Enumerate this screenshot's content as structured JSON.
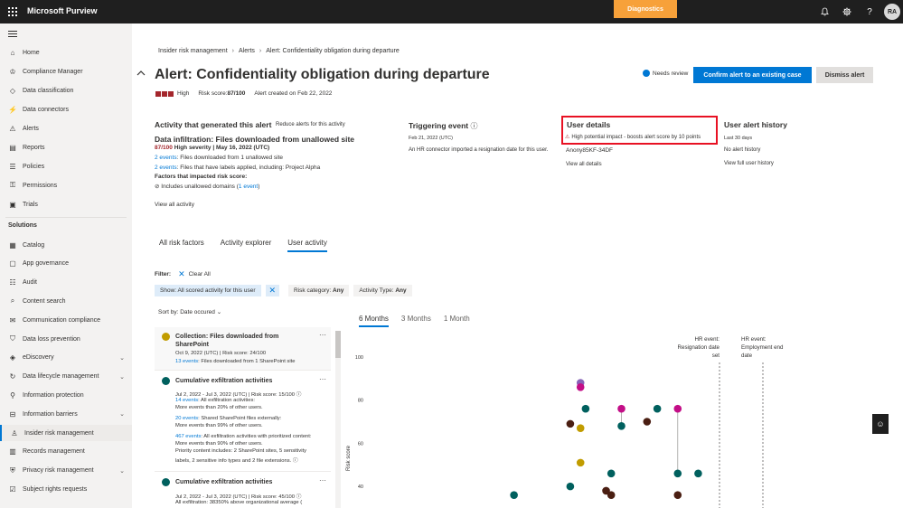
{
  "topbar": {
    "app_title": "Microsoft Purview",
    "diagnostics_label": "Diagnostics",
    "avatar_initials": "RA"
  },
  "sidebar": {
    "items": [
      {
        "label": "Home",
        "icon": "home-icon"
      },
      {
        "label": "Compliance Manager",
        "icon": "trophy-icon"
      },
      {
        "label": "Data classification",
        "icon": "tag-icon"
      },
      {
        "label": "Data connectors",
        "icon": "plug-icon"
      },
      {
        "label": "Alerts",
        "icon": "bell-icon"
      },
      {
        "label": "Reports",
        "icon": "chart-icon"
      },
      {
        "label": "Policies",
        "icon": "policy-icon"
      },
      {
        "label": "Permissions",
        "icon": "key-icon"
      },
      {
        "label": "Trials",
        "icon": "trial-icon"
      }
    ],
    "solutions_header": "Solutions",
    "solutions": [
      {
        "label": "Catalog",
        "icon": "catalog-icon",
        "chevron": false
      },
      {
        "label": "App governance",
        "icon": "app-icon",
        "chevron": false
      },
      {
        "label": "Audit",
        "icon": "audit-icon",
        "chevron": false
      },
      {
        "label": "Content search",
        "icon": "search-icon",
        "chevron": false
      },
      {
        "label": "Communication compliance",
        "icon": "chat-icon",
        "chevron": false
      },
      {
        "label": "Data loss prevention",
        "icon": "shield-icon",
        "chevron": false
      },
      {
        "label": "eDiscovery",
        "icon": "ediscovery-icon",
        "chevron": true
      },
      {
        "label": "Data lifecycle management",
        "icon": "lifecycle-icon",
        "chevron": true
      },
      {
        "label": "Information protection",
        "icon": "lock-icon",
        "chevron": false
      },
      {
        "label": "Information barriers",
        "icon": "barrier-icon",
        "chevron": true
      },
      {
        "label": "Insider risk management",
        "icon": "insider-icon",
        "chevron": false,
        "active": true
      },
      {
        "label": "Records management",
        "icon": "records-icon",
        "chevron": false
      },
      {
        "label": "Privacy risk management",
        "icon": "privacy-icon",
        "chevron": true
      },
      {
        "label": "Subject rights requests",
        "icon": "rights-icon",
        "chevron": false
      }
    ]
  },
  "breadcrumb": [
    "Insider risk management",
    "Alerts",
    "Alert: Confidentiality obligation during departure"
  ],
  "header": {
    "title": "Alert: Confidentiality obligation during departure",
    "severity": "High",
    "risk_score_label": "Risk score: ",
    "risk_score_value": "87/100",
    "created": "Alert created on Feb 22, 2022",
    "status": "Needs review",
    "confirm_button": "Confirm alert to an existing case",
    "dismiss_button": "Dismiss alert"
  },
  "activity": {
    "heading": "Activity that generated this alert",
    "reduce_link": "Reduce alerts for this activity",
    "title": "Data infiltration: Files downloaded from unallowed site",
    "score": "87/100",
    "severity_text": " High severity | May 16, 2022 (UTC)",
    "line1_link": "2 events",
    "line1_text": ": Files downloaded from 1 unallowed site",
    "line2_link": "2 events",
    "line2_text": ": Files that have labels applied, including: Project Alpha",
    "factors_heading": "Factors that impacted risk score:",
    "factor_text": "Includes unallowed domains (",
    "factor_link": "1 event",
    "factor_close": ")",
    "view_all": "View all activity"
  },
  "triggering": {
    "heading": "Triggering event",
    "date": "Feb 21, 2022 (UTC)",
    "desc": "An HR connector imported a resignation date for this user."
  },
  "user_details": {
    "heading": "User details",
    "impact": "High potential impact - boosts alert score by 10 points",
    "user": "Anony85KF-34DF",
    "view_link": "View all details"
  },
  "alert_history": {
    "heading": "User alert history",
    "range": "Last 30 days",
    "status": "No alert history",
    "link": "View full user history"
  },
  "tabs": [
    "All risk factors",
    "Activity explorer",
    "User activity"
  ],
  "filters": {
    "label": "Filter:",
    "clear": "Clear All",
    "show_chip": "Show: All scored activity for this user",
    "risk_label": "Risk category:",
    "risk_value": "Any",
    "activity_label": "Activity Type:",
    "activity_value": "Any"
  },
  "sort": "Sort by: Date occured",
  "time_tabs": [
    "6 Months",
    "3 Months",
    "1 Month"
  ],
  "cards": [
    {
      "color": "#c19c00",
      "title": "Collection: Files downloaded from SharePoint",
      "lines": [
        "Oct 9, 2022 (UTC) | Risk score: 24/100"
      ],
      "link": "13 events",
      "link_text": ": Files downloaded from 1 SharePoint site"
    },
    {
      "color": "#00605e",
      "title": "Cumulative exfiltration activities",
      "l1": "Jul 2, 2022 - Jul 3, 2022 (UTC) | Risk score: 15/100 ⓘ",
      "l2_link": "14 events",
      "l2": ": All exfiltration activities:",
      "l3": "More events than 20% of other users.",
      "l4_link": "20 events",
      "l4": ": Shared SharePoint files externally:",
      "l5": "More events than 99% of other users.",
      "l6_link": "467 events",
      "l6": ": All exfiltration activities with prioritized content:",
      "l7": "More events than 90% of other users.",
      "l8": "Priority content includes: 2 SharePoint sites, 5 sensitivity",
      "l9": "labels, 2 sensitive info types and 2 file extensions. ⓘ"
    },
    {
      "color": "#00605e",
      "title": "Cumulative exfiltration activities",
      "l1": "Jul 2, 2022 - Jul 3, 2022 (UTC) | Risk score: 45/100 ⓘ",
      "l2": "All exfiltration: 38350% above organizational average ("
    }
  ],
  "chart_data": {
    "type": "scatter",
    "ylabel": "Risk score",
    "yticks": [
      40,
      60,
      80,
      100
    ],
    "events": [
      {
        "label": "HR event: Resignation date set"
      },
      {
        "label": "HR event: Employment end date"
      }
    ],
    "points_colors": {
      "teal": "#00605e",
      "brown": "#4a1e12",
      "gold": "#c19c00",
      "magenta": "#c30e87",
      "purple": "#8764b8"
    },
    "points": [
      {
        "x": 0.07,
        "y": 36,
        "c": "teal"
      },
      {
        "x": 0.18,
        "y": 40,
        "c": "teal"
      },
      {
        "x": 0.18,
        "y": 69,
        "c": "brown"
      },
      {
        "x": 0.2,
        "y": 88,
        "c": "purple"
      },
      {
        "x": 0.2,
        "y": 86,
        "c": "magenta"
      },
      {
        "x": 0.2,
        "y": 67,
        "c": "gold"
      },
      {
        "x": 0.2,
        "y": 51,
        "c": "gold"
      },
      {
        "x": 0.21,
        "y": 76,
        "c": "teal"
      },
      {
        "x": 0.25,
        "y": 38,
        "c": "brown"
      },
      {
        "x": 0.26,
        "y": 46,
        "c": "teal"
      },
      {
        "x": 0.26,
        "y": 36,
        "c": "brown"
      },
      {
        "x": 0.28,
        "y": 76,
        "c": "magenta"
      },
      {
        "x": 0.28,
        "y": 68,
        "c": "teal"
      },
      {
        "x": 0.33,
        "y": 70,
        "c": "brown"
      },
      {
        "x": 0.35,
        "y": 76,
        "c": "teal"
      },
      {
        "x": 0.39,
        "y": 76,
        "c": "magenta"
      },
      {
        "x": 0.39,
        "y": 46,
        "c": "teal"
      },
      {
        "x": 0.39,
        "y": 36,
        "c": "brown"
      },
      {
        "x": 0.43,
        "y": 46,
        "c": "teal"
      }
    ]
  }
}
